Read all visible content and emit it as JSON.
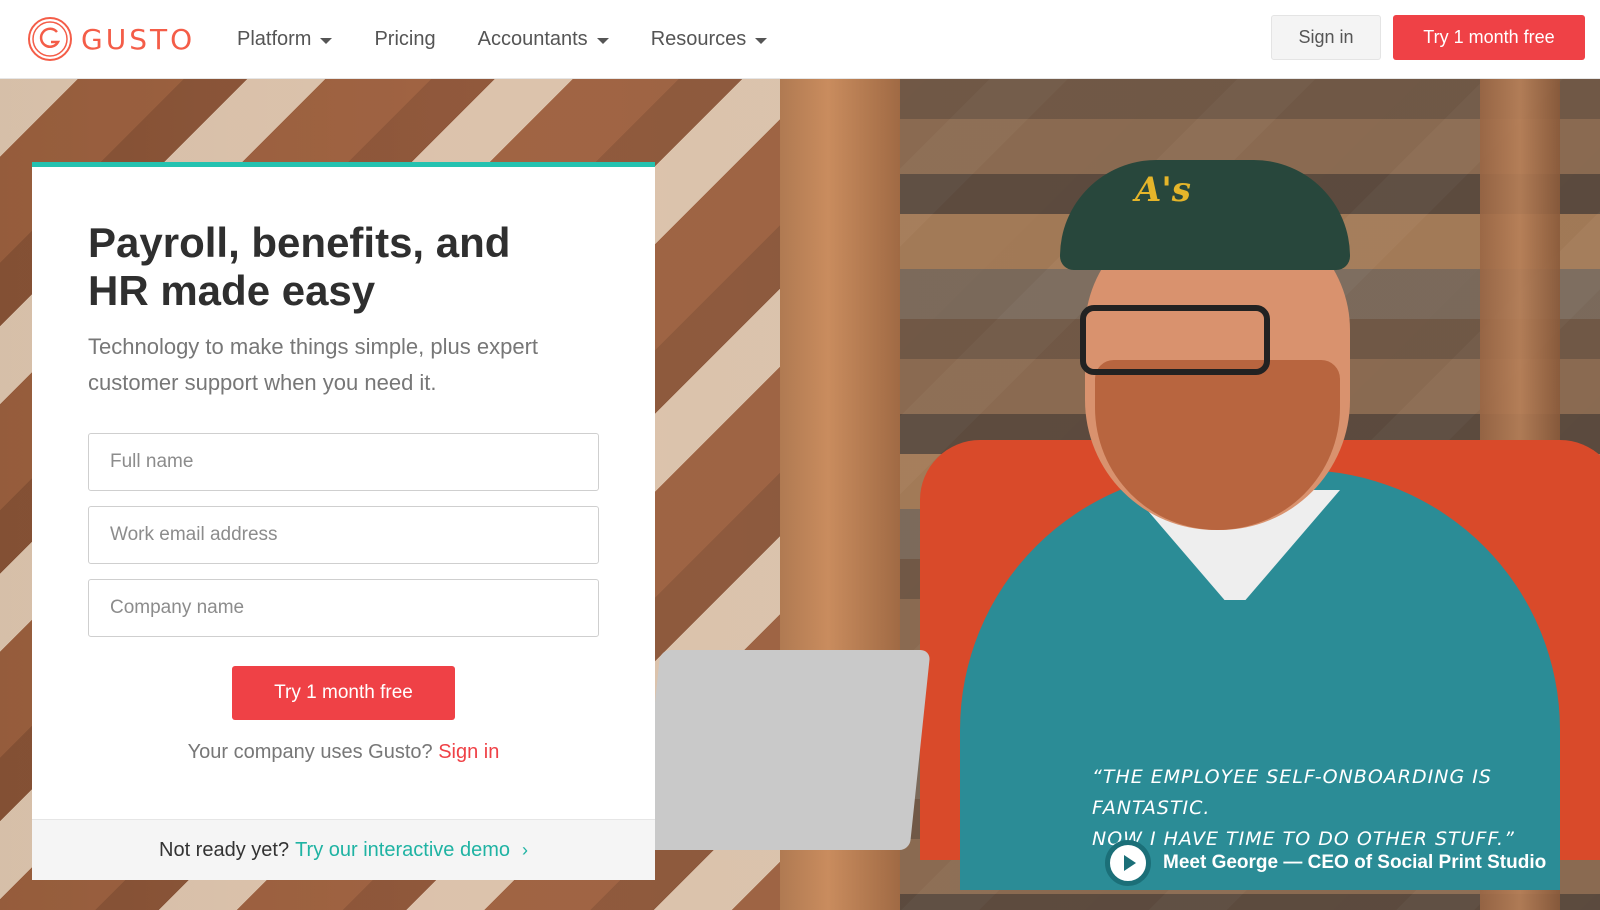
{
  "header": {
    "brand": "GUSTO",
    "nav": [
      {
        "label": "Platform",
        "has_dropdown": true
      },
      {
        "label": "Pricing",
        "has_dropdown": false
      },
      {
        "label": "Accountants",
        "has_dropdown": true
      },
      {
        "label": "Resources",
        "has_dropdown": true
      }
    ],
    "signin_label": "Sign in",
    "cta_label": "Try 1 month free"
  },
  "card": {
    "title_line1": "Payroll, benefits, and",
    "title_line2": "HR made easy",
    "subtitle": "Technology to make things simple, plus expert customer support when you need it.",
    "fields": {
      "full_name_placeholder": "Full name",
      "email_placeholder": "Work email address",
      "company_placeholder": "Company name"
    },
    "cta_label": "Try 1 month free",
    "signin_prompt": "Your company uses Gusto?",
    "signin_link": "Sign in",
    "footer_prompt": "Not ready yet?",
    "footer_link": "Try our interactive demo"
  },
  "testimonial": {
    "quote_line1": "“The employee self-onboarding is fantastic.",
    "quote_line2": "Now I have time to do other stuff.”",
    "meet_label": "Meet George — CEO of Social Print Studio"
  },
  "colors": {
    "brand": "#f45d48",
    "cta": "#ef4146",
    "accent": "#24c2b0"
  }
}
